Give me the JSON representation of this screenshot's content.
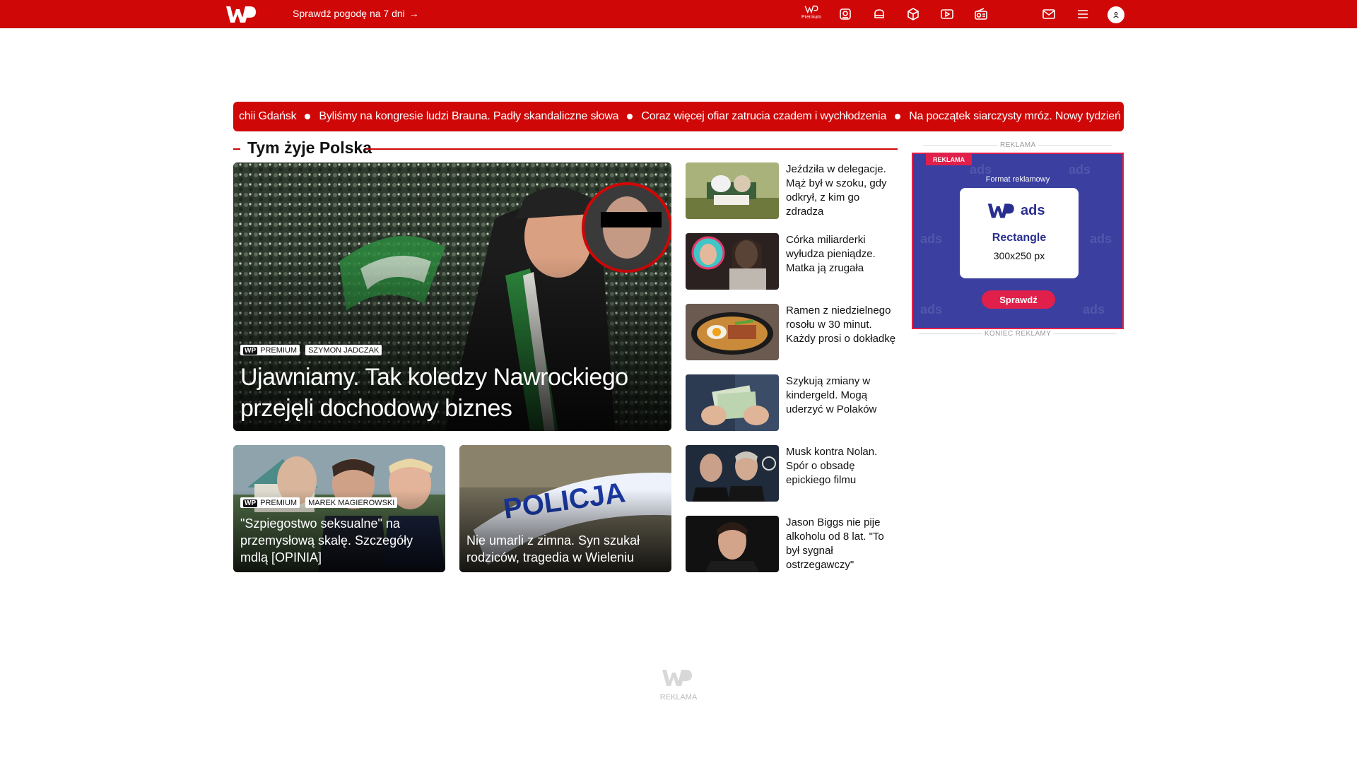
{
  "header": {
    "weather_link": "Sprawdź pogodę na 7 dni",
    "premium_label": "Premium",
    "brand_color": "#d00707",
    "icons": [
      "premium-icon",
      "horoscope-icon",
      "cooking-icon",
      "package-icon",
      "video-icon",
      "radio-icon",
      "mail-icon",
      "menu-icon",
      "user-icon"
    ]
  },
  "ticker": {
    "items": [
      "chii Gdańsk",
      "Byliśmy na kongresie ludzi Brauna. Padły skandaliczne słowa",
      "Coraz więcej ofiar zatrucia czadem i wychłodzenia",
      "Na początek siarczysty mróz. Nowy tydzień zamiesza w po"
    ]
  },
  "section": {
    "title": "Tym żyje Polska"
  },
  "main_story": {
    "badge_premium": "PREMIUM",
    "author": "SZYMON JADCZAK",
    "headline": "Ujawniamy. Tak koledzy Nawrockiego przejęli dochodowy biznes"
  },
  "sub_stories": [
    {
      "badge_premium": "PREMIUM",
      "author": "MAREK MAGIEROWSKI",
      "headline": "\"Szpiegostwo seksualne\" na przemysłową skalę. Szczegóły mdlą [OPINIA]"
    },
    {
      "headline": "Nie umarli z zimna. Syn szukał rodziców, tragedia w Wieleniu",
      "image_text": "POLICJA"
    }
  ],
  "side_list": [
    "Jeździła w delegacje. Mąż był w szoku, gdy odkrył, z kim go zdradza",
    "Córka miliarderki wyłudza pieniądze. Matka ją zrugała",
    "Ramen z niedzielnego rosołu w 30 minut. Każdy prosi o dokładkę",
    "Szykują zmiany w kindergeld. Mogą uderzyć w Polaków",
    "Musk kontra Nolan. Spór o obsadę epickiego filmu",
    "Jason Biggs nie pije alkoholu od 8 lat. \"To był sygnał ostrzegawczy\""
  ],
  "ad": {
    "label_top": "REKLAMA",
    "label_bottom": "KONIEC REKLAMY",
    "tag": "REKLAMA",
    "format_text": "Format reklamowy",
    "brand": "ads",
    "product": "Rectangle",
    "size": "300x250 px",
    "cta": "Sprawdź",
    "bg_word": "ads"
  },
  "footer_ad": {
    "label": "REKLAMA"
  }
}
